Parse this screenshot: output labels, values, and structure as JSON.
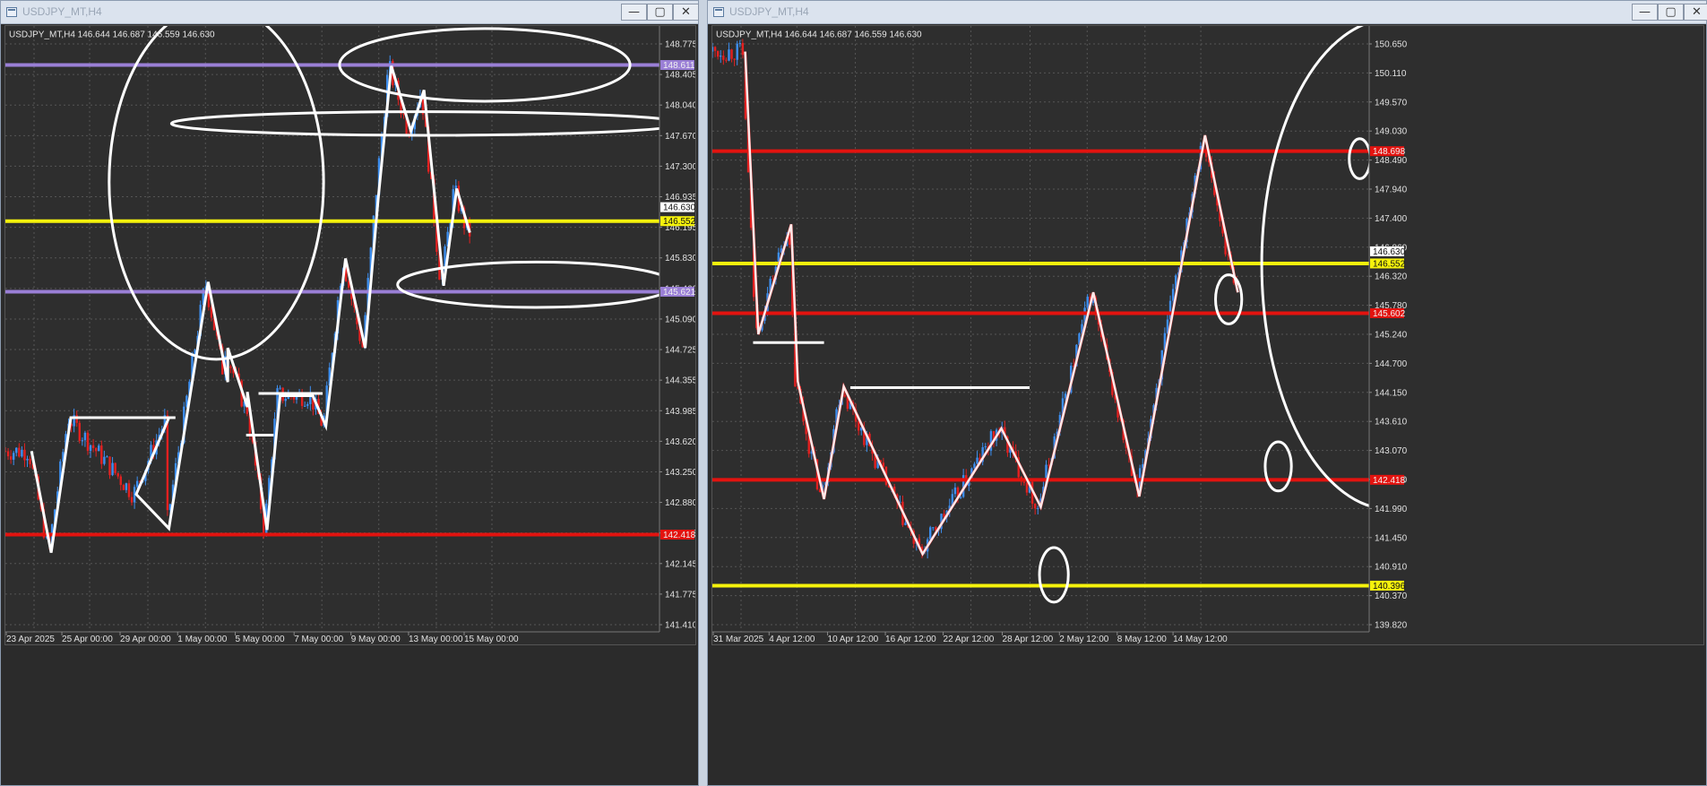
{
  "colors": {
    "background": "#2e2e2e",
    "grid": "#555555",
    "bull": "#3d8ff0",
    "bear": "#e32020",
    "purple": "#9a7fd6",
    "yellow": "#f5f20c",
    "red": "#e3130f",
    "white": "#ffffff"
  },
  "windows": [
    {
      "title": "USDJPY_MT,H4",
      "info": "USDJPY_MT,H4  146.644 146.687 146.559 146.630",
      "buttons": {
        "minimize": "—",
        "maximize": "▢",
        "close": "✕"
      },
      "price_labels": [
        "148.775",
        "148.405",
        "148.040",
        "147.670",
        "147.300",
        "146.935",
        "146.195",
        "145.830",
        "145.460",
        "145.090",
        "144.725",
        "144.355",
        "143.985",
        "143.620",
        "143.250",
        "142.880",
        "142.515",
        "142.145",
        "141.775",
        "141.410"
      ],
      "time_labels": [
        "23 Apr 2025",
        "25 Apr 00:00",
        "29 Apr 00:00",
        "1 May 00:00",
        "5 May 00:00",
        "7 May 00:00",
        "9 May 00:00",
        "13 May 00:00",
        "15 May 00:00"
      ],
      "current_price": "146.630",
      "tags": [
        {
          "text": "148.611",
          "color": "#9a7fd6",
          "fg": "#f0f0f0"
        },
        {
          "text": "146.552",
          "color": "#f5f20c",
          "fg": "#111111"
        },
        {
          "text": "145.621",
          "color": "#9a7fd6",
          "fg": "#f0f0f0"
        },
        {
          "text": "142.418",
          "color": "#e3130f",
          "fg": "#f0f0f0"
        }
      ]
    },
    {
      "title": "USDJPY_MT,H4",
      "info": "USDJPY_MT,H4  146.644 146.687 146.559 146.630",
      "buttons": {
        "minimize": "—",
        "maximize": "▢",
        "close": "✕"
      },
      "price_labels": [
        "150.650",
        "150.110",
        "149.570",
        "149.030",
        "148.490",
        "147.940",
        "147.400",
        "146.860",
        "146.320",
        "145.780",
        "145.240",
        "144.700",
        "144.150",
        "143.610",
        "143.070",
        "142.530",
        "141.990",
        "141.450",
        "140.910",
        "140.370",
        "139.820"
      ],
      "time_labels": [
        "31 Mar 2025",
        "4 Apr 12:00",
        "10 Apr 12:00",
        "16 Apr 12:00",
        "22 Apr 12:00",
        "28 Apr 12:00",
        "2 May 12:00",
        "8 May 12:00",
        "14 May 12:00"
      ],
      "current_price": "146.630",
      "tags": [
        {
          "text": "148.698",
          "color": "#e3130f",
          "fg": "#f0f0f0"
        },
        {
          "text": "146.552",
          "color": "#f5f20c",
          "fg": "#111111"
        },
        {
          "text": "145.602",
          "color": "#e3130f",
          "fg": "#f0f0f0"
        },
        {
          "text": "142.418",
          "color": "#e3130f",
          "fg": "#f0f0f0"
        },
        {
          "text": "140.396",
          "color": "#f5f20c",
          "fg": "#111111"
        }
      ]
    }
  ],
  "chart_data": [
    {
      "type": "candlestick",
      "symbol": "USDJPY_MT",
      "timeframe": "H4",
      "title": "USDJPY_MT,H4",
      "ylim": [
        141.23,
        148.96
      ],
      "horizontal_lines": [
        {
          "price": 148.611,
          "color": "purple"
        },
        {
          "price": 146.552,
          "color": "yellow"
        },
        {
          "price": 145.621,
          "color": "purple"
        },
        {
          "price": 142.418,
          "color": "red"
        }
      ],
      "zigzag": [
        [
          0.04,
          143.52
        ],
        [
          0.07,
          142.18
        ],
        [
          0.1,
          143.96
        ],
        [
          0.25,
          143.96
        ],
        [
          0.2,
          142.95
        ],
        [
          0.25,
          142.5
        ],
        [
          0.31,
          145.75
        ],
        [
          0.34,
          144.43
        ],
        [
          0.34,
          144.88
        ],
        [
          0.37,
          144.1
        ],
        [
          0.37,
          144.3
        ],
        [
          0.4,
          142.48
        ],
        [
          0.42,
          144.25
        ],
        [
          0.47,
          144.25
        ],
        [
          0.49,
          143.85
        ],
        [
          0.52,
          146.06
        ],
        [
          0.55,
          144.88
        ],
        [
          0.57,
          146.85
        ],
        [
          0.59,
          148.6
        ],
        [
          0.62,
          147.74
        ],
        [
          0.64,
          148.28
        ],
        [
          0.67,
          145.7
        ],
        [
          0.69,
          146.98
        ],
        [
          0.71,
          146.4
        ]
      ]
    },
    {
      "type": "candlestick",
      "symbol": "USDJPY_MT",
      "timeframe": "H4",
      "title": "USDJPY_MT,H4",
      "ylim": [
        139.65,
        150.85
      ],
      "horizontal_lines": [
        {
          "price": 148.698,
          "color": "red"
        },
        {
          "price": 146.552,
          "color": "yellow"
        },
        {
          "price": 145.602,
          "color": "red"
        },
        {
          "price": 142.418,
          "color": "red"
        },
        {
          "price": 140.396,
          "color": "yellow"
        }
      ],
      "zigzag": [
        [
          0.05,
          150.6
        ],
        [
          0.07,
          145.2
        ],
        [
          0.12,
          147.3
        ],
        [
          0.13,
          144.3
        ],
        [
          0.17,
          142.05
        ],
        [
          0.2,
          144.2
        ],
        [
          0.32,
          141.0
        ],
        [
          0.35,
          141.6
        ],
        [
          0.44,
          143.4
        ],
        [
          0.5,
          141.9
        ],
        [
          0.58,
          146.0
        ],
        [
          0.65,
          142.1
        ],
        [
          0.75,
          149.0
        ],
        [
          0.8,
          146.0
        ]
      ]
    }
  ]
}
